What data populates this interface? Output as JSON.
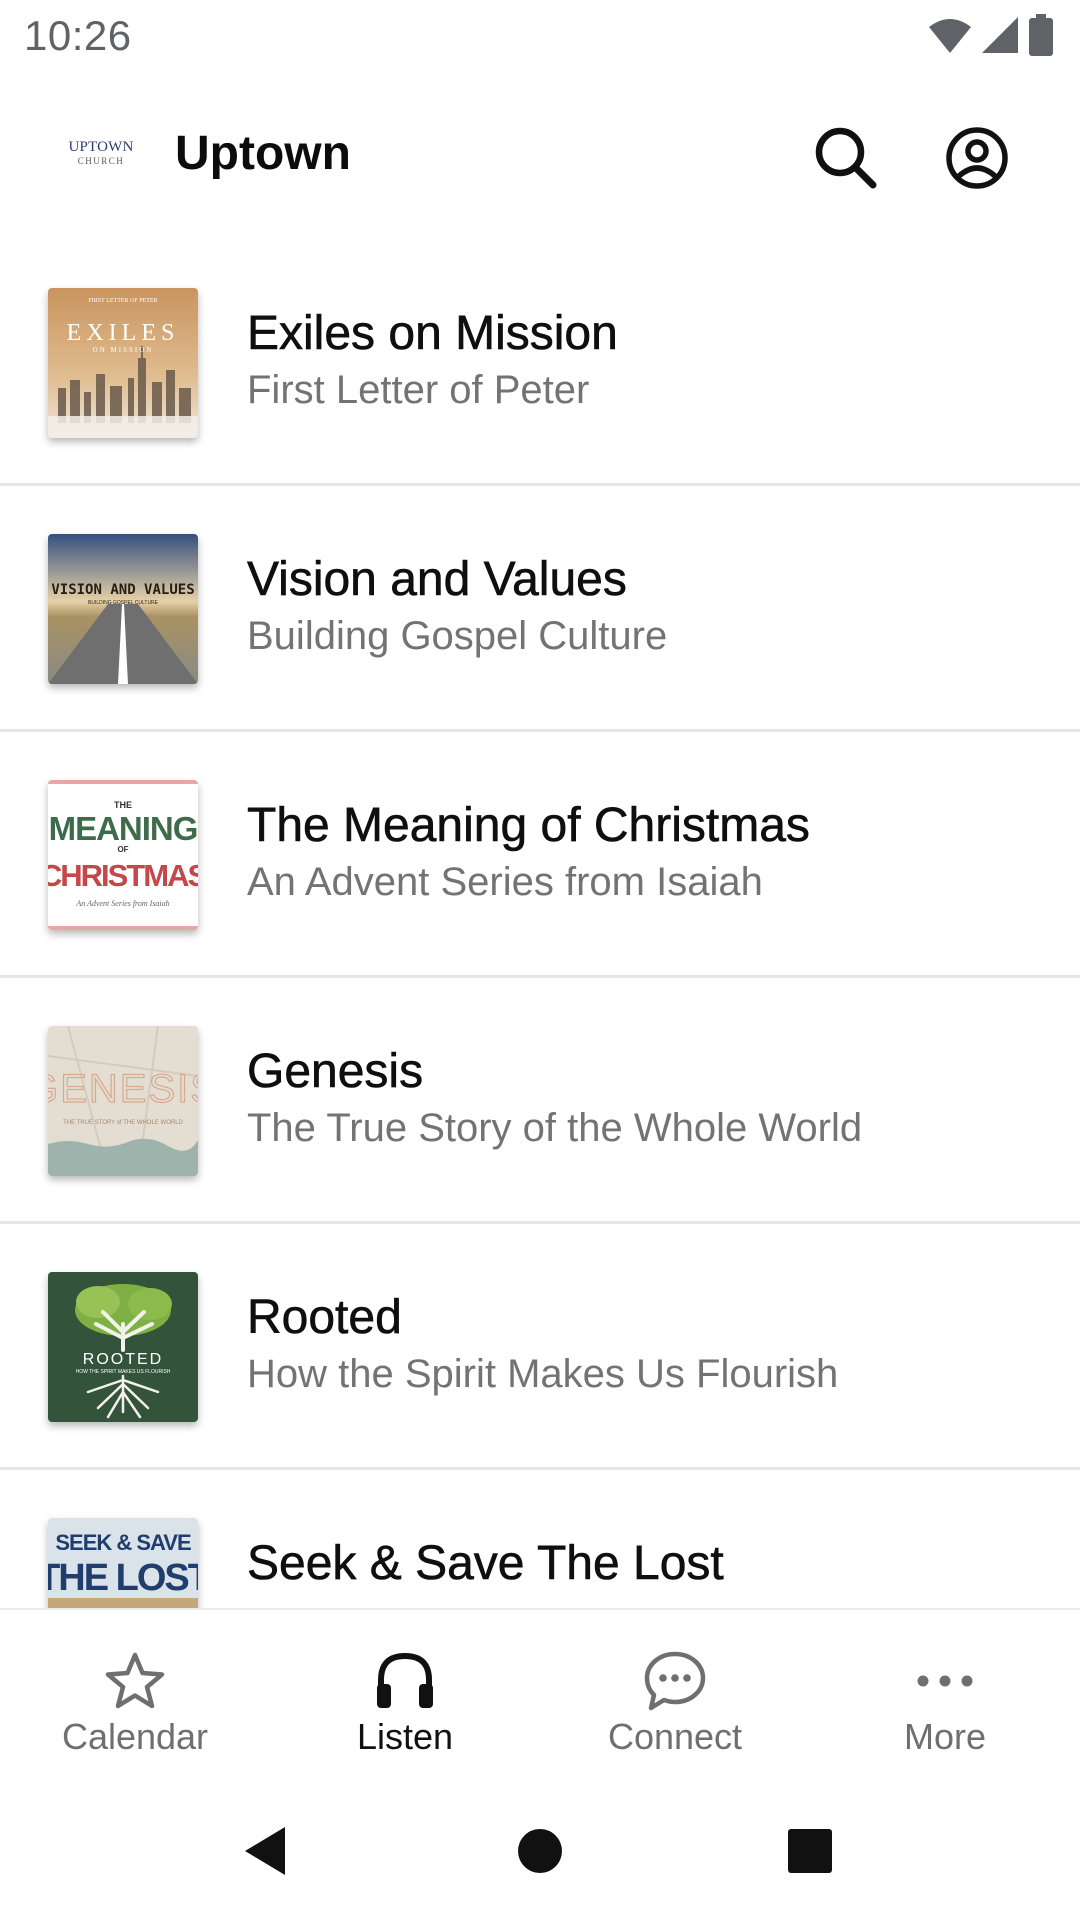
{
  "status_bar": {
    "time": "10:26"
  },
  "app_bar": {
    "logo_line1": "UPTOWN",
    "logo_line2": "CHURCH",
    "title": "Uptown"
  },
  "series": [
    {
      "title": "Exiles on Mission",
      "subtitle": "First Letter of Peter",
      "art_text": "EXILES",
      "art_small": "ON MISSION",
      "art_top": "FIRST LETTER OF PETER"
    },
    {
      "title": "Vision and Values",
      "subtitle": "Building Gospel Culture",
      "art_text": "VISION AND VALUES",
      "art_small": "BUILDING GOSPEL CULTURE"
    },
    {
      "title": "The Meaning of Christmas",
      "subtitle": "An Advent Series from Isaiah",
      "art_the": "THE",
      "art_line1": "MEANING",
      "art_of": "OF",
      "art_line2": "CHRISTMAS",
      "art_small": "An Advent Series from Isaiah"
    },
    {
      "title": "Genesis",
      "subtitle": "The True Story of the Whole World",
      "art_text": "GENESIS",
      "art_small": "THE TRUE STORY of THE WHOLE WORLD"
    },
    {
      "title": "Rooted",
      "subtitle": "How the Spirit Makes Us Flourish",
      "art_text": "ROOTED",
      "art_small": "HOW THE SPIRIT MAKES US FLOURISH"
    },
    {
      "title": "Seek & Save The Lost",
      "subtitle": "",
      "art_line1": "SEEK & SAVE",
      "art_line2": "THE LOST"
    }
  ],
  "bottom_nav": [
    {
      "label": "Calendar",
      "icon": "star-icon",
      "active": false
    },
    {
      "label": "Listen",
      "icon": "headphones-icon",
      "active": true
    },
    {
      "label": "Connect",
      "icon": "chat-bubble-icon",
      "active": false
    },
    {
      "label": "More",
      "icon": "more-dots-icon",
      "active": false
    }
  ],
  "colors": {
    "active_nav": "#111111",
    "inactive_nav": "#6f6f6f",
    "subtitle": "#737373",
    "divider": "#e6e6e6"
  }
}
